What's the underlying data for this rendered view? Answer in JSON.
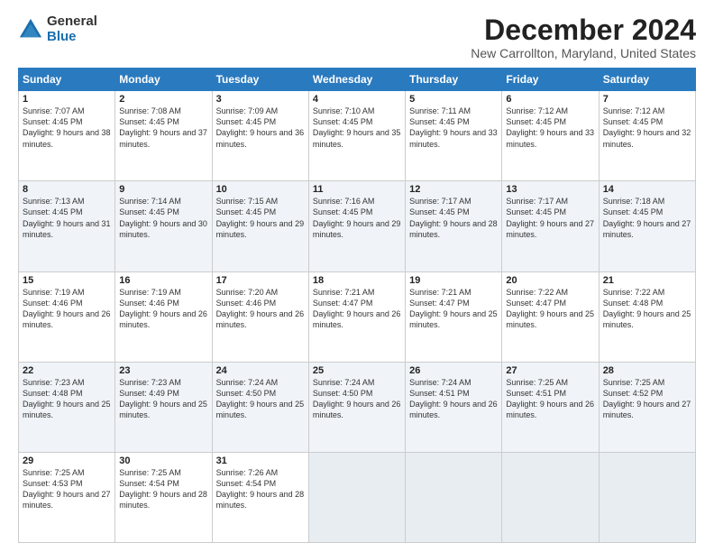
{
  "logo": {
    "general": "General",
    "blue": "Blue"
  },
  "header": {
    "month": "December 2024",
    "location": "New Carrollton, Maryland, United States"
  },
  "days_of_week": [
    "Sunday",
    "Monday",
    "Tuesday",
    "Wednesday",
    "Thursday",
    "Friday",
    "Saturday"
  ],
  "weeks": [
    [
      {
        "day": "1",
        "sunrise": "7:07 AM",
        "sunset": "4:45 PM",
        "daylight": "9 hours and 38 minutes."
      },
      {
        "day": "2",
        "sunrise": "7:08 AM",
        "sunset": "4:45 PM",
        "daylight": "9 hours and 37 minutes."
      },
      {
        "day": "3",
        "sunrise": "7:09 AM",
        "sunset": "4:45 PM",
        "daylight": "9 hours and 36 minutes."
      },
      {
        "day": "4",
        "sunrise": "7:10 AM",
        "sunset": "4:45 PM",
        "daylight": "9 hours and 35 minutes."
      },
      {
        "day": "5",
        "sunrise": "7:11 AM",
        "sunset": "4:45 PM",
        "daylight": "9 hours and 33 minutes."
      },
      {
        "day": "6",
        "sunrise": "7:12 AM",
        "sunset": "4:45 PM",
        "daylight": "9 hours and 33 minutes."
      },
      {
        "day": "7",
        "sunrise": "7:12 AM",
        "sunset": "4:45 PM",
        "daylight": "9 hours and 32 minutes."
      }
    ],
    [
      {
        "day": "8",
        "sunrise": "7:13 AM",
        "sunset": "4:45 PM",
        "daylight": "9 hours and 31 minutes."
      },
      {
        "day": "9",
        "sunrise": "7:14 AM",
        "sunset": "4:45 PM",
        "daylight": "9 hours and 30 minutes."
      },
      {
        "day": "10",
        "sunrise": "7:15 AM",
        "sunset": "4:45 PM",
        "daylight": "9 hours and 29 minutes."
      },
      {
        "day": "11",
        "sunrise": "7:16 AM",
        "sunset": "4:45 PM",
        "daylight": "9 hours and 29 minutes."
      },
      {
        "day": "12",
        "sunrise": "7:17 AM",
        "sunset": "4:45 PM",
        "daylight": "9 hours and 28 minutes."
      },
      {
        "day": "13",
        "sunrise": "7:17 AM",
        "sunset": "4:45 PM",
        "daylight": "9 hours and 27 minutes."
      },
      {
        "day": "14",
        "sunrise": "7:18 AM",
        "sunset": "4:45 PM",
        "daylight": "9 hours and 27 minutes."
      }
    ],
    [
      {
        "day": "15",
        "sunrise": "7:19 AM",
        "sunset": "4:46 PM",
        "daylight": "9 hours and 26 minutes."
      },
      {
        "day": "16",
        "sunrise": "7:19 AM",
        "sunset": "4:46 PM",
        "daylight": "9 hours and 26 minutes."
      },
      {
        "day": "17",
        "sunrise": "7:20 AM",
        "sunset": "4:46 PM",
        "daylight": "9 hours and 26 minutes."
      },
      {
        "day": "18",
        "sunrise": "7:21 AM",
        "sunset": "4:47 PM",
        "daylight": "9 hours and 26 minutes."
      },
      {
        "day": "19",
        "sunrise": "7:21 AM",
        "sunset": "4:47 PM",
        "daylight": "9 hours and 25 minutes."
      },
      {
        "day": "20",
        "sunrise": "7:22 AM",
        "sunset": "4:47 PM",
        "daylight": "9 hours and 25 minutes."
      },
      {
        "day": "21",
        "sunrise": "7:22 AM",
        "sunset": "4:48 PM",
        "daylight": "9 hours and 25 minutes."
      }
    ],
    [
      {
        "day": "22",
        "sunrise": "7:23 AM",
        "sunset": "4:48 PM",
        "daylight": "9 hours and 25 minutes."
      },
      {
        "day": "23",
        "sunrise": "7:23 AM",
        "sunset": "4:49 PM",
        "daylight": "9 hours and 25 minutes."
      },
      {
        "day": "24",
        "sunrise": "7:24 AM",
        "sunset": "4:50 PM",
        "daylight": "9 hours and 25 minutes."
      },
      {
        "day": "25",
        "sunrise": "7:24 AM",
        "sunset": "4:50 PM",
        "daylight": "9 hours and 26 minutes."
      },
      {
        "day": "26",
        "sunrise": "7:24 AM",
        "sunset": "4:51 PM",
        "daylight": "9 hours and 26 minutes."
      },
      {
        "day": "27",
        "sunrise": "7:25 AM",
        "sunset": "4:51 PM",
        "daylight": "9 hours and 26 minutes."
      },
      {
        "day": "28",
        "sunrise": "7:25 AM",
        "sunset": "4:52 PM",
        "daylight": "9 hours and 27 minutes."
      }
    ],
    [
      {
        "day": "29",
        "sunrise": "7:25 AM",
        "sunset": "4:53 PM",
        "daylight": "9 hours and 27 minutes."
      },
      {
        "day": "30",
        "sunrise": "7:25 AM",
        "sunset": "4:54 PM",
        "daylight": "9 hours and 28 minutes."
      },
      {
        "day": "31",
        "sunrise": "7:26 AM",
        "sunset": "4:54 PM",
        "daylight": "9 hours and 28 minutes."
      },
      null,
      null,
      null,
      null
    ]
  ]
}
